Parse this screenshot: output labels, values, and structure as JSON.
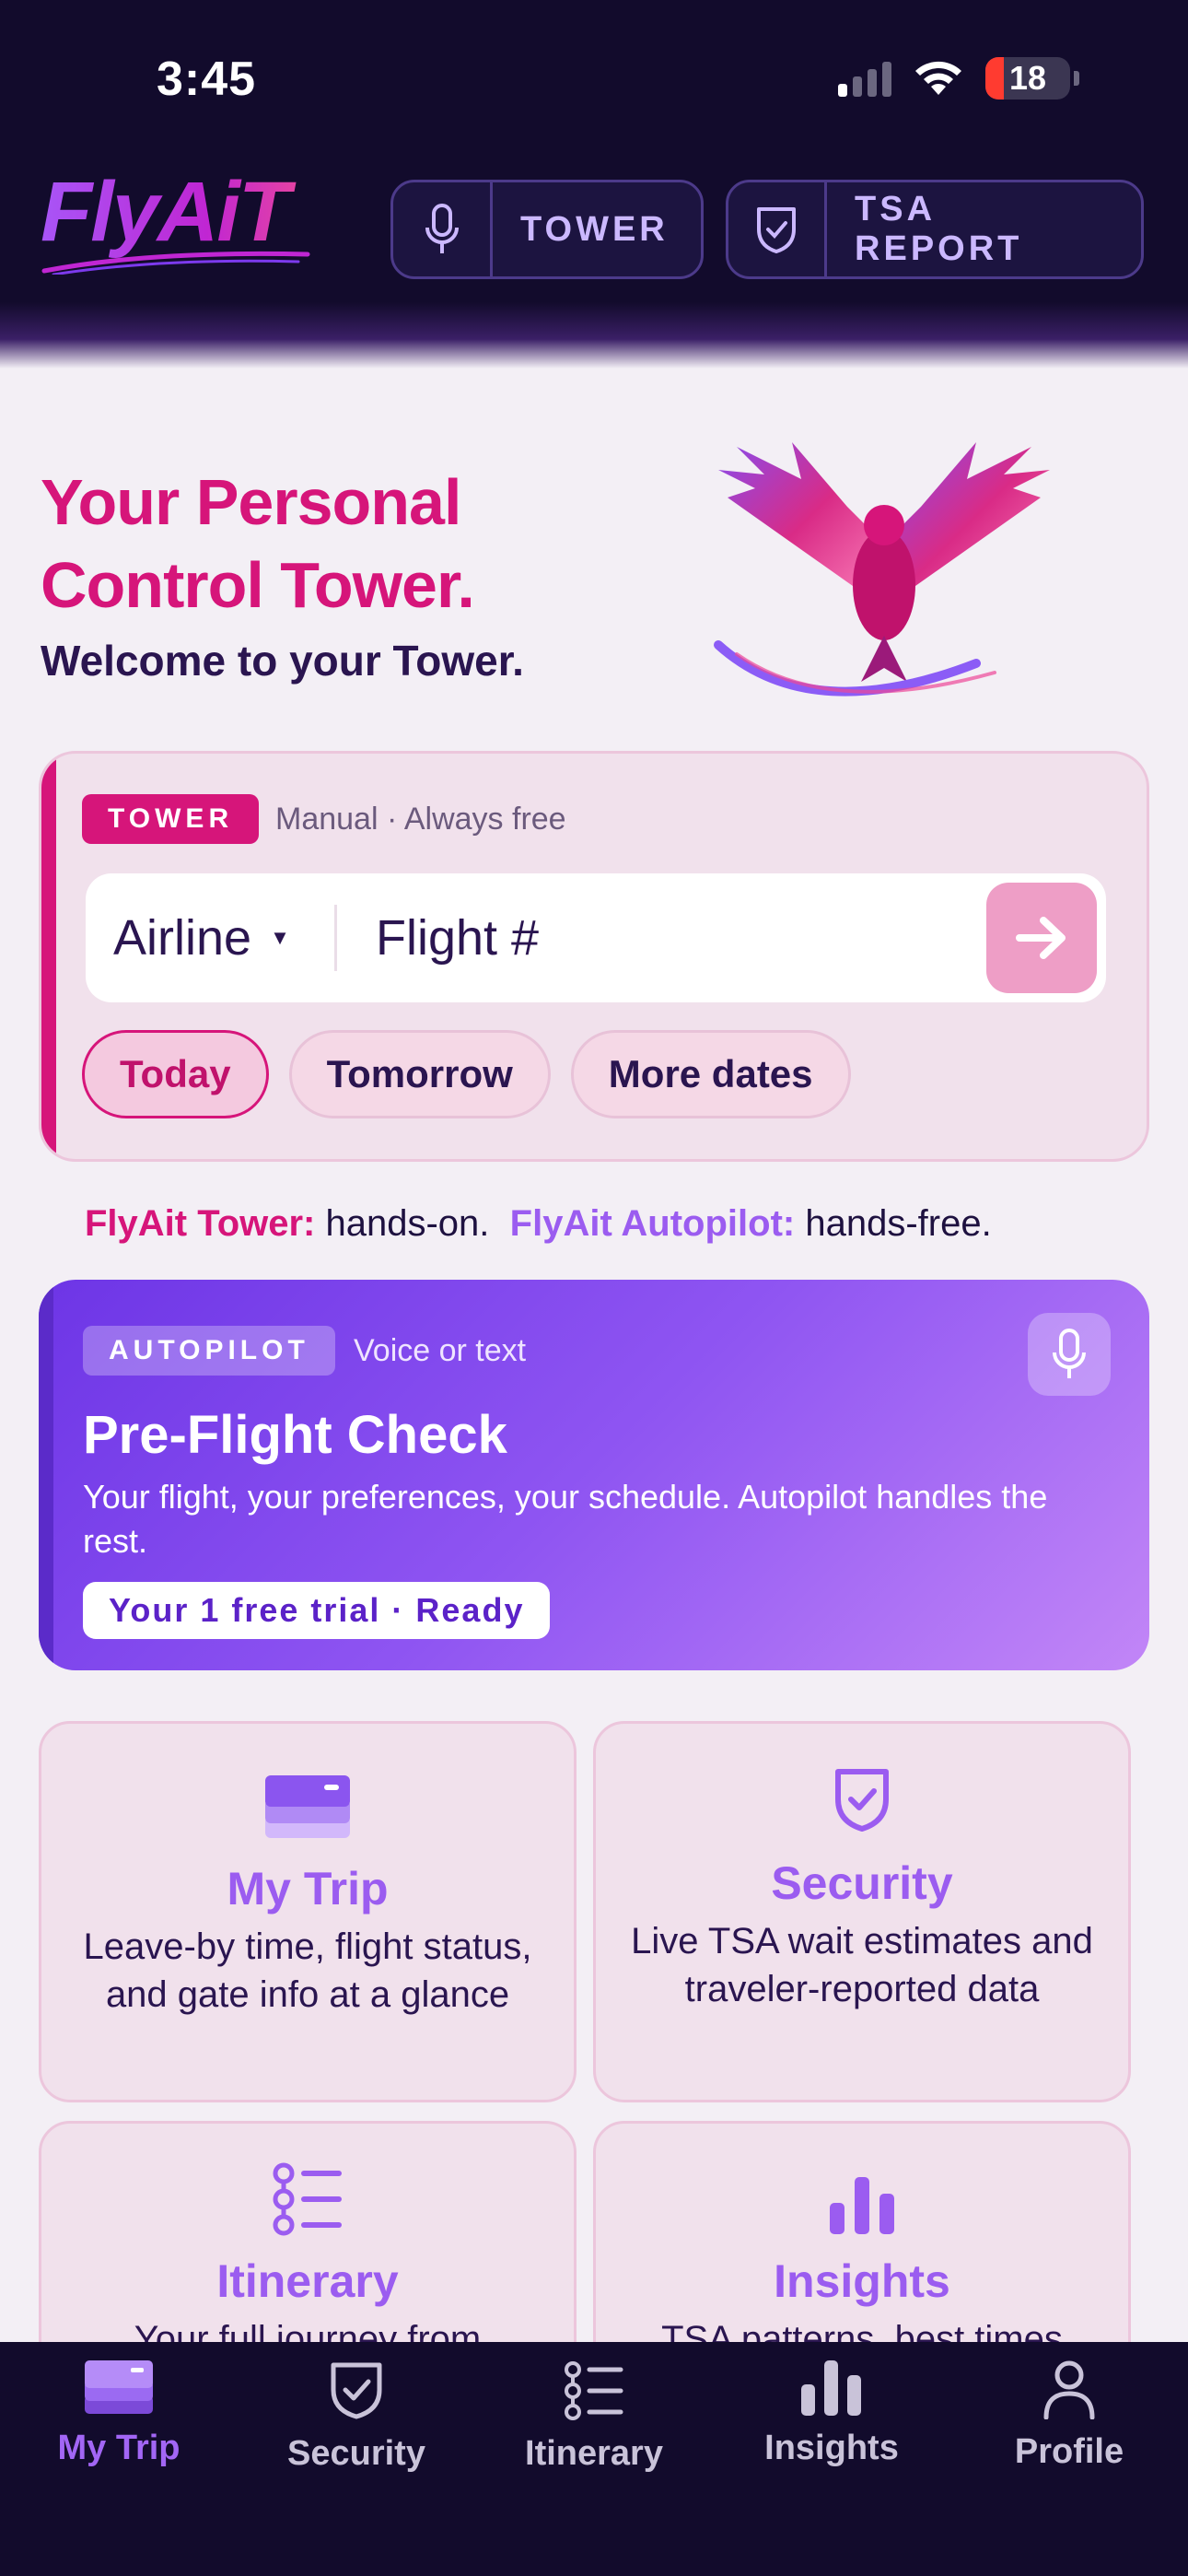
{
  "status_bar": {
    "time": "3:45",
    "battery": "18"
  },
  "header": {
    "logo": "FlyAiT",
    "tower_button": "TOWER",
    "tsa_button": "TSA REPORT"
  },
  "hero": {
    "title_line1": "Your Personal",
    "title_line2": "Control Tower.",
    "subtitle": "Welcome to your Tower."
  },
  "tower_card": {
    "tag": "TOWER",
    "meta": "Manual · Always free",
    "airline_value": "Airline",
    "flight_placeholder": "Flight #",
    "dates": [
      "Today",
      "Tomorrow",
      "More dates"
    ]
  },
  "tagline": {
    "tower_label": "FlyAit Tower:",
    "tower_text": "hands-on.",
    "autopilot_label": "FlyAit Autopilot:",
    "autopilot_text": "hands-free."
  },
  "autopilot_card": {
    "tag": "AUTOPILOT",
    "meta": "Voice or text",
    "title": "Pre-Flight Check",
    "description": "Your flight, your preferences, your schedule. Autopilot handles the rest.",
    "trial": "Your 1 free trial · Ready"
  },
  "features": [
    {
      "title": "My Trip",
      "description": "Leave-by time, flight status, and gate info at a glance",
      "icon": "card-stack-icon"
    },
    {
      "title": "Security",
      "description": "Live TSA wait estimates and traveler-reported data",
      "icon": "shield-check-icon"
    },
    {
      "title": "Itinerary",
      "description": "Your full journey from",
      "icon": "list-icon"
    },
    {
      "title": "Insights",
      "description": "TSA patterns, best times",
      "icon": "bar-chart-icon"
    }
  ],
  "tabs": [
    {
      "label": "My Trip",
      "icon": "card-stack-icon"
    },
    {
      "label": "Security",
      "icon": "shield-check-icon"
    },
    {
      "label": "Itinerary",
      "icon": "list-icon"
    },
    {
      "label": "Insights",
      "icon": "bar-chart-icon"
    },
    {
      "label": "Profile",
      "icon": "person-icon"
    }
  ],
  "colors": {
    "brand_pink": "#d6157a",
    "brand_purple": "#9b5cf0",
    "header_bg": "#120b2c"
  }
}
